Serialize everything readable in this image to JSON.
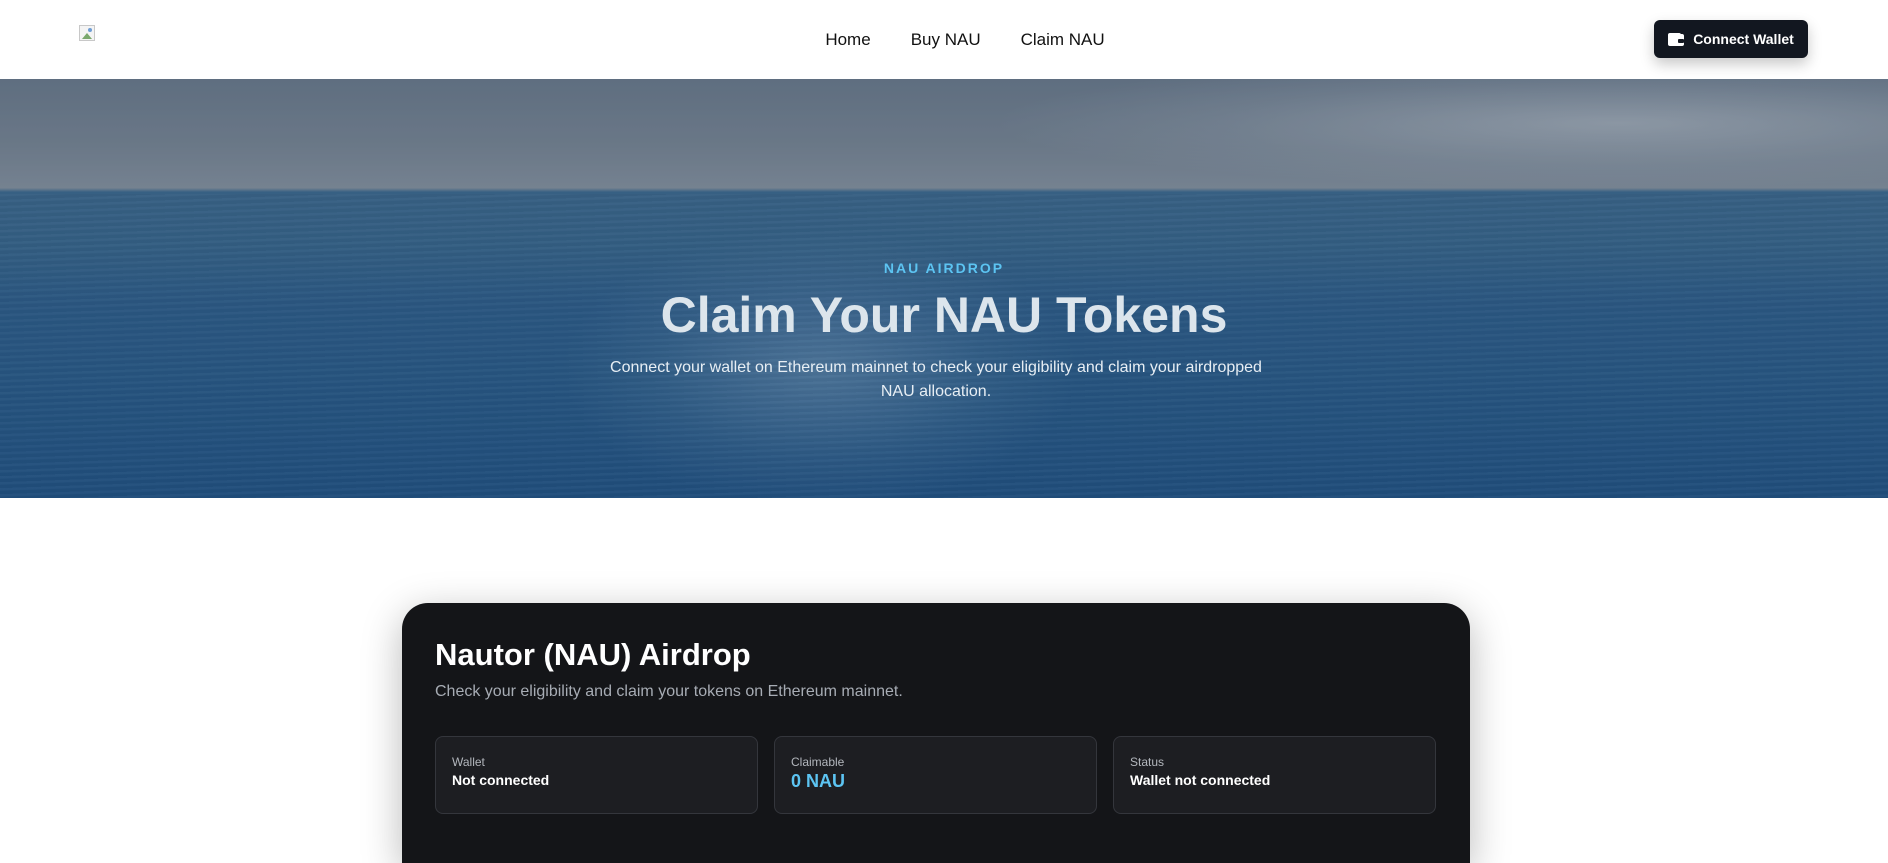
{
  "nav": {
    "links": [
      "Home",
      "Buy NAU",
      "Claim NAU"
    ],
    "connect_label": "Connect Wallet"
  },
  "hero": {
    "eyebrow": "NAU AIRDROP",
    "title": "Claim Your NAU Tokens",
    "subtitle": "Connect your wallet on Ethereum mainnet to check your eligibility and claim your airdropped NAU allocation."
  },
  "card": {
    "title": "Nautor (NAU) Airdrop",
    "subtitle": "Check your eligibility and claim your tokens on Ethereum mainnet.",
    "stats": [
      {
        "label": "Wallet",
        "value": "Not connected"
      },
      {
        "label": "Claimable",
        "value": "0 NAU"
      },
      {
        "label": "Status",
        "value": "Wallet not connected"
      }
    ]
  },
  "colors": {
    "accent": "#5cc4f2",
    "button_bg": "#121720",
    "card_bg": "#141518"
  },
  "icons": {
    "logo": "broken-image-icon",
    "connect": "wallet-icon"
  }
}
